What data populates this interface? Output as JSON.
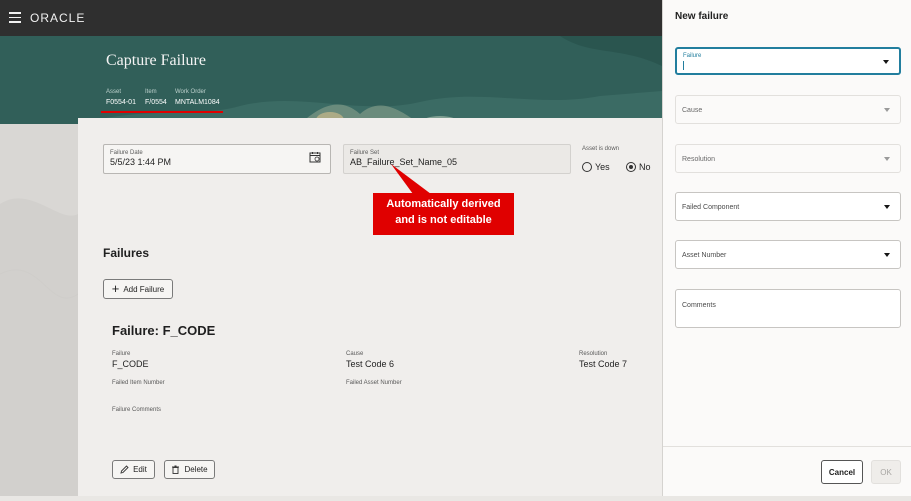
{
  "topbar": {
    "brand": "ORACLE"
  },
  "page": {
    "title": "Capture Failure",
    "meta": {
      "asset_label": "Asset",
      "asset_value": "F0554-01",
      "item_label": "Item",
      "item_value": "F/0554",
      "work_order_label": "Work Order",
      "work_order_value": "MNTALM1084"
    }
  },
  "form": {
    "failure_date_label": "Failure Date",
    "failure_date_value": "5/5/23 1:44 PM",
    "failure_set_label": "Failure Set",
    "failure_set_value": "AB_Failure_Set_Name_05",
    "asset_down_label": "Asset is down",
    "yes_label": "Yes",
    "no_label": "No",
    "asset_down_selected": "No"
  },
  "callout": {
    "line1": "Automatically derived",
    "line2": "and is not editable"
  },
  "failures": {
    "heading": "Failures",
    "add_label": "Add Failure",
    "item": {
      "title": "Failure: F_CODE",
      "failure_label": "Failure",
      "failure_value": "F_CODE",
      "cause_label": "Cause",
      "cause_value": "Test Code 6",
      "resolution_label": "Resolution",
      "resolution_value": "Test Code 7",
      "failed_item_label": "Failed Item Number",
      "failed_asset_label": "Failed Asset Number",
      "comments_label": "Failure Comments",
      "edit_label": "Edit",
      "delete_label": "Delete"
    }
  },
  "drawer": {
    "title": "New failure",
    "fields": {
      "failure": "Failure",
      "cause": "Cause",
      "resolution": "Resolution",
      "failed_component": "Failed Component",
      "asset_number": "Asset Number",
      "comments": "Comments"
    },
    "cancel_label": "Cancel",
    "ok_label": "OK"
  },
  "colors": {
    "accent": "#227e9e",
    "highlight": "#e00000",
    "banner": "#315f59"
  }
}
